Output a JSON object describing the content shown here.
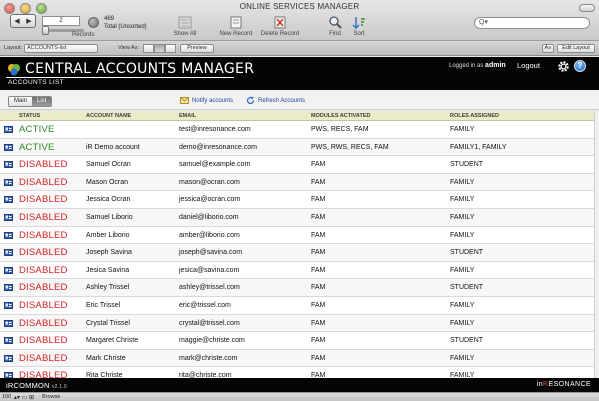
{
  "window": {
    "title": "ONLINE SERVICES MANAGER"
  },
  "toolbar": {
    "record_number": "2",
    "records_label": "Records",
    "found_count": "469",
    "found_label": "Total (Unsorted)",
    "buttons": [
      {
        "label": "Show All",
        "icon": "show-all-icon"
      },
      {
        "label": "New Record",
        "icon": "new-record-icon"
      },
      {
        "label": "Delete Record",
        "icon": "delete-record-icon"
      },
      {
        "label": "Find",
        "icon": "find-icon"
      },
      {
        "label": "Sort",
        "icon": "sort-icon"
      }
    ],
    "search_glyph": "Q▾"
  },
  "layoutbar": {
    "layout_label": "Layout:",
    "layout_value": "ACCOUNTS-list",
    "view_label": "View As:",
    "preview_label": "Preview",
    "font_btn": "A≡",
    "edit_layout_label": "Edit Layout"
  },
  "header": {
    "title": "CENTRAL ACCOUNTS MANAGER",
    "subtitle": "ACCOUNTS LIST",
    "logged_in_label": "Logged in as",
    "username": "admin",
    "logout_label": "Logout",
    "help_glyph": "?"
  },
  "subbar": {
    "tabs": [
      "Main",
      "List"
    ],
    "notify_label": "Notify accounts",
    "refresh_label": "Refresh Accounts"
  },
  "table": {
    "columns": [
      "STATUS",
      "ACCOUNT NAME",
      "EMAIL",
      "MODULES ACTIVATED",
      "ROLES ASSIGNED"
    ],
    "rows": [
      {
        "status": "ACTIVE",
        "name": "",
        "email": "test@inresonance.com",
        "modules": "PWS, RECS, FAM",
        "roles": "FAMILY"
      },
      {
        "status": "ACTIVE",
        "name": "iR Demo account",
        "email": "demo@inresonance.com",
        "modules": "PWS, RWS, RECS, FAM",
        "roles": "FAMILY1, FAMILY"
      },
      {
        "status": "DISABLED",
        "name": "Samuel Ocran",
        "email": "samuel@example.com",
        "modules": "FAM",
        "roles": "STUDENT"
      },
      {
        "status": "DISABLED",
        "name": "Mason Ocran",
        "email": "mason@ocran.com",
        "modules": "FAM",
        "roles": "FAMILY"
      },
      {
        "status": "DISABLED",
        "name": "Jessica Ocran",
        "email": "jessica@ocran.com",
        "modules": "FAM",
        "roles": "FAMILY"
      },
      {
        "status": "DISABLED",
        "name": "Samuel Liborio",
        "email": "daniel@liborio.com",
        "modules": "FAM",
        "roles": "FAMILY"
      },
      {
        "status": "DISABLED",
        "name": "Amber Liborio",
        "email": "amber@liborio.com",
        "modules": "FAM",
        "roles": "FAMILY"
      },
      {
        "status": "DISABLED",
        "name": "Joseph Savina",
        "email": "joseph@savina.com",
        "modules": "FAM",
        "roles": "STUDENT"
      },
      {
        "status": "DISABLED",
        "name": "Jesica Savina",
        "email": "jesica@savina.com",
        "modules": "FAM",
        "roles": "FAMILY"
      },
      {
        "status": "DISABLED",
        "name": "Ashley Trissel",
        "email": "ashley@trissel.com",
        "modules": "FAM",
        "roles": "STUDENT"
      },
      {
        "status": "DISABLED",
        "name": "Eric Trissel",
        "email": "eric@trissel.com",
        "modules": "FAM",
        "roles": "FAMILY"
      },
      {
        "status": "DISABLED",
        "name": "Crystal Trissel",
        "email": "crystal@trissel.com",
        "modules": "FAM",
        "roles": "FAMILY"
      },
      {
        "status": "DISABLED",
        "name": "Margaret Christe",
        "email": "maggie@christe.com",
        "modules": "FAM",
        "roles": "STUDENT"
      },
      {
        "status": "DISABLED",
        "name": "Mark Christe",
        "email": "mark@christe.com",
        "modules": "FAM",
        "roles": "FAMILY"
      },
      {
        "status": "DISABLED",
        "name": "Rita Christe",
        "email": "rita@christe.com",
        "modules": "FAM",
        "roles": "FAMILY"
      }
    ]
  },
  "footer": {
    "app_name": "iRCOMMON",
    "version": "v2.1.0",
    "brand_prefix": "in",
    "brand_accent": "R",
    "brand_suffix": "ESONANCE"
  },
  "statusbar": {
    "zoom": "100",
    "mode": "Browse"
  },
  "colors": {
    "active": "#2b8a2b",
    "disabled": "#d32020",
    "header_bg": "#050505",
    "column_header_bg": "#ecebc9",
    "brand_accent": "#d84a2a"
  }
}
